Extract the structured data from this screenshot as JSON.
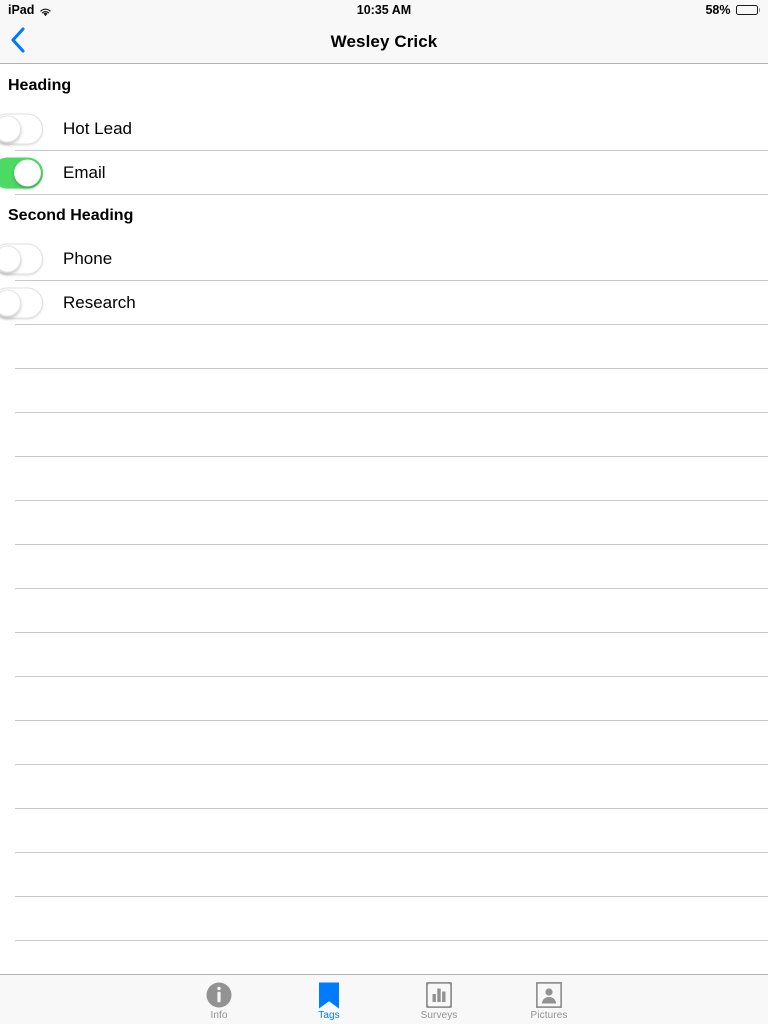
{
  "status_bar": {
    "device": "iPad",
    "wifi_icon": "wifi-icon",
    "time": "10:35 AM",
    "battery_percent": "58%",
    "battery_level": 58,
    "battery_icon": "battery-icon"
  },
  "nav_bar": {
    "back_icon": "chevron-left-icon",
    "title": "Wesley Crick"
  },
  "sections": [
    {
      "header": "Heading",
      "rows": [
        {
          "label": "Hot Lead",
          "switch_on": false,
          "switch_name": "toggle-hot-lead"
        },
        {
          "label": "Email",
          "switch_on": true,
          "switch_name": "toggle-email"
        }
      ]
    },
    {
      "header": "Second Heading",
      "rows": [
        {
          "label": "Phone",
          "switch_on": false,
          "switch_name": "toggle-phone"
        },
        {
          "label": "Research",
          "switch_on": false,
          "switch_name": "toggle-research"
        }
      ]
    }
  ],
  "empty_row_count": 15,
  "tab_bar": {
    "items": [
      {
        "label": "Info",
        "icon": "info-circle-icon",
        "active": false
      },
      {
        "label": "Tags",
        "icon": "bookmark-icon",
        "active": true
      },
      {
        "label": "Surveys",
        "icon": "bar-chart-icon",
        "active": false
      },
      {
        "label": "Pictures",
        "icon": "picture-person-icon",
        "active": false
      }
    ]
  },
  "colors": {
    "accent_blue": "#007aff",
    "switch_on_green": "#4cd964",
    "inactive_gray": "#929292",
    "separator": "#c8c7cc",
    "bar_background": "#f8f8f8"
  }
}
